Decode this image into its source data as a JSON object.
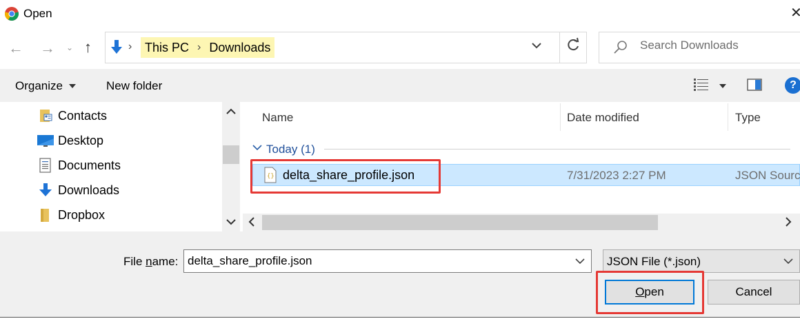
{
  "window": {
    "title": "Open",
    "close_glyph": "✕"
  },
  "nav_buttons": {
    "back": "←",
    "forward": "→",
    "recent": "⌄",
    "up": "↑"
  },
  "address": {
    "crumbs": [
      "This PC",
      "Downloads"
    ],
    "separator": "›"
  },
  "search": {
    "placeholder": "Search Downloads"
  },
  "toolbar": {
    "organize_label": "Organize",
    "new_folder_label": "New folder",
    "help_label": "?"
  },
  "nav_pane": {
    "items": [
      {
        "label": "Contacts",
        "icon": "contacts-icon"
      },
      {
        "label": "Desktop",
        "icon": "desktop-icon"
      },
      {
        "label": "Documents",
        "icon": "documents-icon"
      },
      {
        "label": "Downloads",
        "icon": "downloads-icon"
      },
      {
        "label": "Dropbox",
        "icon": "dropbox-folder-icon"
      }
    ]
  },
  "file_list": {
    "columns": [
      "Name",
      "Date modified",
      "Type"
    ],
    "group_label": "Today (1)",
    "rows": [
      {
        "name": "delta_share_profile.json",
        "date": "7/31/2023 2:27 PM",
        "type": "JSON Source",
        "selected": true
      }
    ]
  },
  "bottom": {
    "filename_label_pre": "File ",
    "filename_label_u": "n",
    "filename_label_post": "ame:",
    "filename_value": "delta_share_profile.json",
    "filetype_value": "JSON File (*.json)",
    "open_pre": "",
    "open_u": "O",
    "open_post": "pen",
    "cancel_label": "Cancel"
  },
  "colors": {
    "selection": "#cce8ff",
    "highlight": "#e53935",
    "crumb_bg": "#fdf6b3",
    "accent": "#0078d7"
  }
}
